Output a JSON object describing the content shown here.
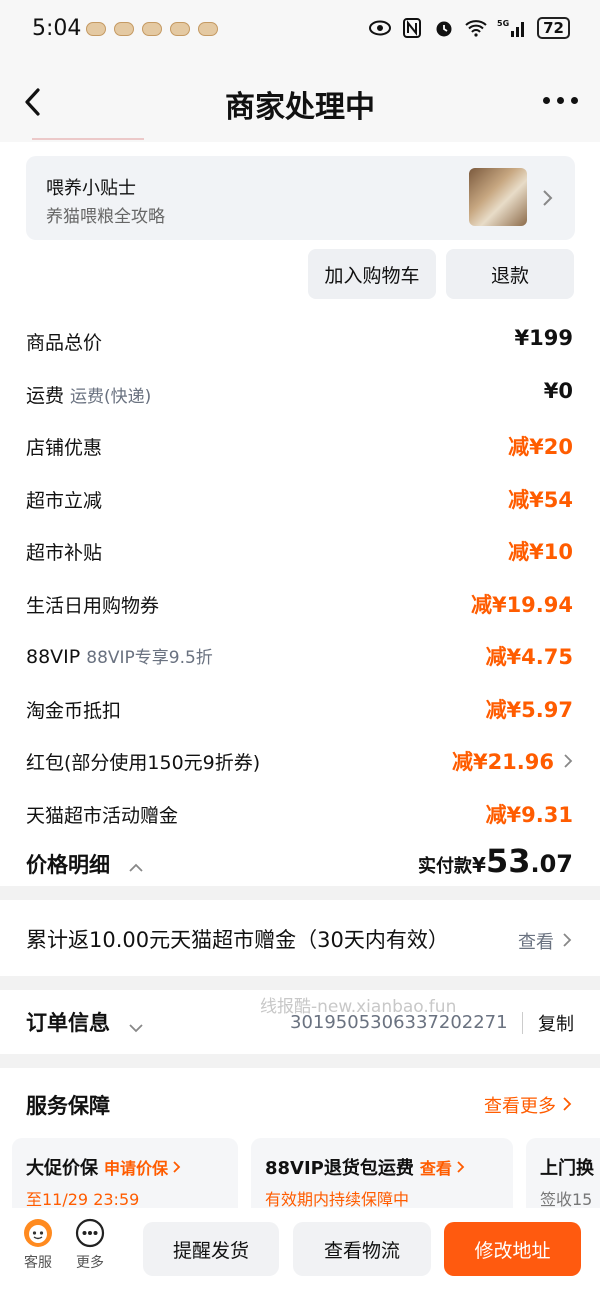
{
  "status": {
    "time": "5:04",
    "battery": "72",
    "network": "5G"
  },
  "nav": {
    "title": "商家处理中"
  },
  "tip": {
    "title": "喂养小贴士",
    "subtitle": "养猫喂粮全攻略"
  },
  "actions": {
    "add_cart": "加入购物车",
    "refund": "退款"
  },
  "price_rows": [
    {
      "label": "商品总价",
      "sub": "",
      "value": "¥199"
    },
    {
      "label": "运费",
      "sub": "运费(快递)",
      "value": "¥0"
    },
    {
      "label": "店铺优惠",
      "sub": "",
      "value": "减¥20"
    },
    {
      "label": "超市立减",
      "sub": "",
      "value": "减¥54"
    },
    {
      "label": "超市补贴",
      "sub": "",
      "value": "减¥10"
    },
    {
      "label": "生活日用购物券",
      "sub": "",
      "value": "减¥19.94"
    },
    {
      "label": "88VIP",
      "sub": "88VIP专享9.5折",
      "value": "减¥4.75"
    },
    {
      "label": "淘金币抵扣",
      "sub": "",
      "value": "减¥5.97"
    },
    {
      "label": "红包(部分使用150元9折券)",
      "sub": "",
      "value": "减¥21.96"
    },
    {
      "label": "天猫超市活动赠金",
      "sub": "",
      "value": "减¥9.31"
    }
  ],
  "detail": {
    "label": "价格明细",
    "paid_label": "实付款",
    "currency": "¥",
    "amount_int": "53",
    "amount_dec": ".07"
  },
  "cashback": {
    "text": "累计返10.00元天猫超市赠金（30天内有效）",
    "link": "查看"
  },
  "order": {
    "title": "订单信息",
    "number": "3019505306337202271",
    "copy": "复制",
    "watermark": "线报酷-new.xianbao.fun"
  },
  "service": {
    "title": "服务保障",
    "more": "查看更多",
    "cards": [
      {
        "title": "大促价保",
        "action": "申请价保",
        "sub": "至11/29 23:59"
      },
      {
        "title": "88VIP退货包运费",
        "action": "查看",
        "sub": "有效期内持续保障中"
      },
      {
        "title": "上门换",
        "action": "",
        "sub": "签收15"
      }
    ]
  },
  "bottom": {
    "service": "客服",
    "more": "更多",
    "remind": "提醒发货",
    "logistics": "查看物流",
    "modify": "修改地址"
  }
}
